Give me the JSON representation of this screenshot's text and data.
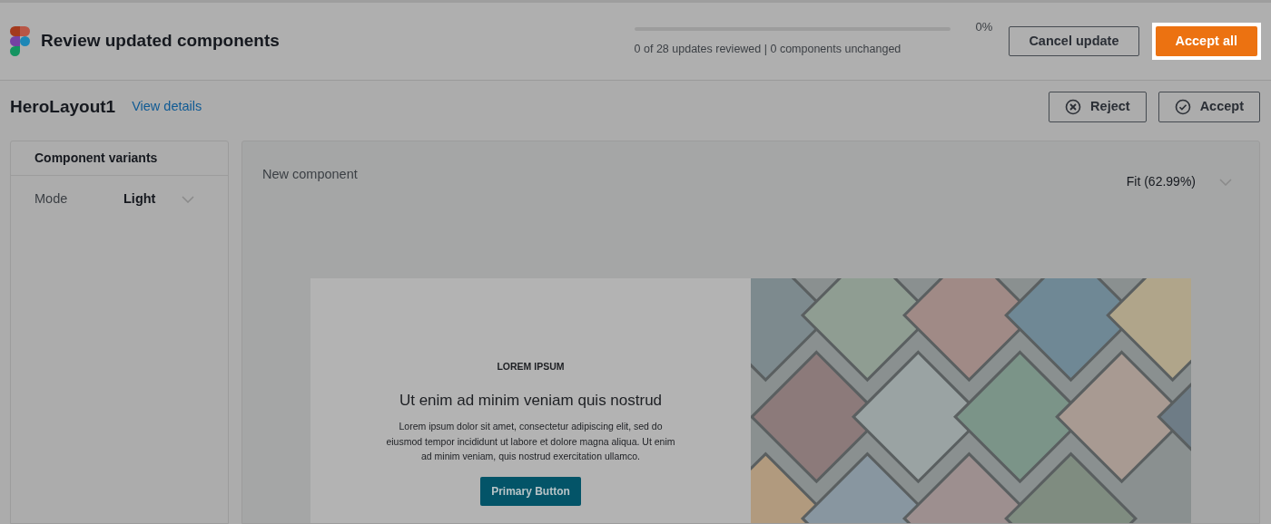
{
  "header": {
    "title": "Review updated components",
    "progress": {
      "level": 0,
      "percent": "0%",
      "summary": "0 of 28 updates reviewed | 0 components unchanged"
    },
    "buttons": [
      {
        "label": "Cancel update",
        "kind": "secondary",
        "highlighted": false
      },
      {
        "label": "Accept all",
        "kind": "primary",
        "highlighted": true
      }
    ]
  },
  "component": {
    "name": "HeroLayout1",
    "link": "View details",
    "actions": [
      {
        "label": "Reject",
        "kind": "reject"
      },
      {
        "label": "Accept",
        "kind": "accept"
      }
    ]
  },
  "variants": {
    "title": "Component variants",
    "rows": [
      {
        "label": "Mode",
        "value": "Light"
      }
    ]
  },
  "preview": {
    "title": "New component",
    "zoom": "Fit (62.99%)",
    "hero": {
      "eyebrow": "LOREM IPSUM",
      "heading": "Ut enim ad minim veniam quis nostrud",
      "body": "Lorem ipsum dolor sit amet, consectetur adipiscing elit, sed do eiusmod tempor incididunt ut labore et dolore magna aliqua. Ut enim ad minim veniam, quis nostrud exercitation ullamco.",
      "button": "Primary Button"
    }
  }
}
